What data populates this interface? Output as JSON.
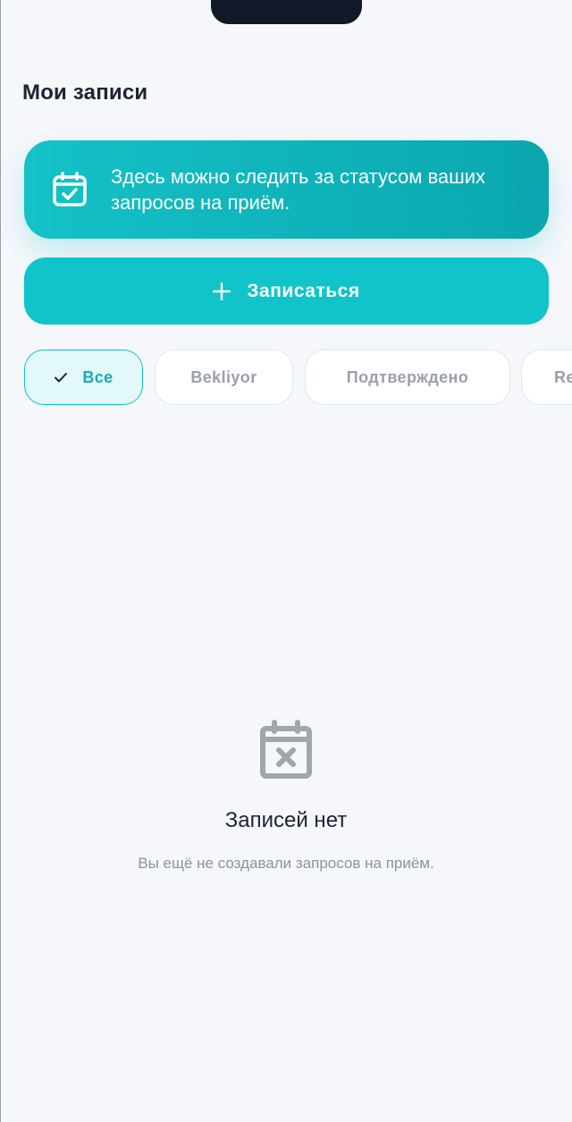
{
  "header": {
    "title": "Мои записи"
  },
  "banner": {
    "icon": "calendar-check-icon",
    "text": "Здесь можно следить за статусом ваших запросов на приём."
  },
  "actions": {
    "book_label": "Записаться",
    "book_icon": "plus-icon"
  },
  "filters": {
    "selected": "Все",
    "items": [
      {
        "label": "Все",
        "active": true
      },
      {
        "label": "Bekliyor",
        "active": false
      },
      {
        "label": "Подтверждено",
        "active": false
      },
      {
        "label": "Re",
        "active": false
      }
    ]
  },
  "empty_state": {
    "icon": "calendar-x-icon",
    "title": "Записей нет",
    "subtitle": "Вы ещё не создавали запросов на приём."
  },
  "colors": {
    "accent": "#10c4c9",
    "accent_dark": "#0aa7ad",
    "background": "#f5f7fb",
    "text_primary": "#1c2433",
    "text_muted": "#8b93a0"
  }
}
